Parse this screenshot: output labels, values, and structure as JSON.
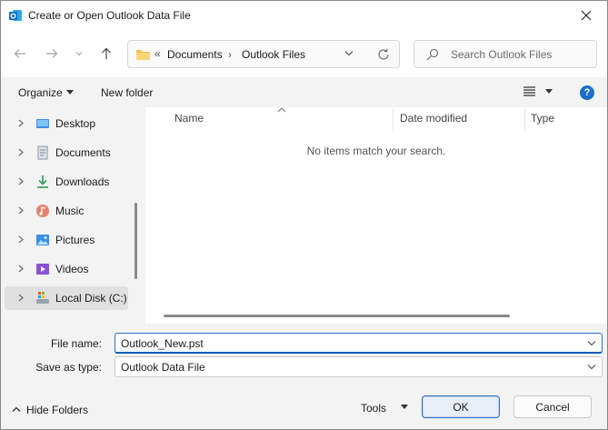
{
  "window": {
    "title": "Create or Open Outlook Data File"
  },
  "address": {
    "prefix": "«",
    "crumbs": [
      "Documents",
      "Outlook Files"
    ],
    "separator": "›"
  },
  "search": {
    "placeholder": "Search Outlook Files"
  },
  "toolbar": {
    "organize": "Organize",
    "new_folder": "New folder"
  },
  "nav": {
    "items": [
      {
        "label": "Desktop",
        "icon": "desktop-icon"
      },
      {
        "label": "Documents",
        "icon": "documents-icon"
      },
      {
        "label": "Downloads",
        "icon": "downloads-icon"
      },
      {
        "label": "Music",
        "icon": "music-icon"
      },
      {
        "label": "Pictures",
        "icon": "pictures-icon"
      },
      {
        "label": "Videos",
        "icon": "videos-icon"
      },
      {
        "label": "Local Disk (C:)",
        "icon": "drive-icon",
        "selected": true
      }
    ]
  },
  "list": {
    "columns": [
      "Name",
      "Date modified",
      "Type"
    ],
    "empty_message": "No items match your search."
  },
  "form": {
    "file_name_label": "File name:",
    "file_name_value": "Outlook_New.pst",
    "save_type_label": "Save as type:",
    "save_type_value": "Outlook Data File"
  },
  "footer": {
    "hide_folders": "Hide Folders",
    "tools": "Tools",
    "ok": "OK",
    "cancel": "Cancel"
  },
  "colors": {
    "accent": "#005fb8",
    "help": "#1a6fc9",
    "folder": "#f2c14e",
    "outlook": "#0f6cbd"
  }
}
